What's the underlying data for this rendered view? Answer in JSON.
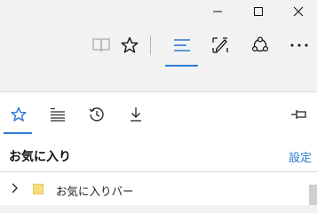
{
  "window": {
    "controls": [
      {
        "name": "minimize-button",
        "icon": "minimize-icon"
      },
      {
        "name": "maximize-button",
        "icon": "maximize-icon"
      },
      {
        "name": "close-button",
        "icon": "close-icon"
      }
    ]
  },
  "toolbar": {
    "buttons": [
      {
        "name": "reading-view-button",
        "icon": "book-icon",
        "enabled": false
      },
      {
        "name": "add-favorite-button",
        "icon": "star-icon"
      },
      {
        "name": "hub-button",
        "icon": "hub-lines-icon",
        "active": true
      },
      {
        "name": "web-note-button",
        "icon": "pen-icon"
      },
      {
        "name": "share-button",
        "icon": "share-icon"
      },
      {
        "name": "more-button",
        "icon": "more-icon"
      }
    ],
    "accent_color": "#2b79d0"
  },
  "hub": {
    "tabs": [
      {
        "name": "tab-favorites",
        "icon": "star-icon",
        "active": true
      },
      {
        "name": "tab-reading-list",
        "icon": "reading-list-icon"
      },
      {
        "name": "tab-history",
        "icon": "history-icon"
      },
      {
        "name": "tab-downloads",
        "icon": "download-icon"
      }
    ],
    "pin_icon": "pin-icon",
    "title": "お気に入り",
    "settings_label": "設定",
    "items": [
      {
        "label": "お気に入りバー",
        "icon": "folder-icon",
        "expanded": false
      }
    ]
  }
}
